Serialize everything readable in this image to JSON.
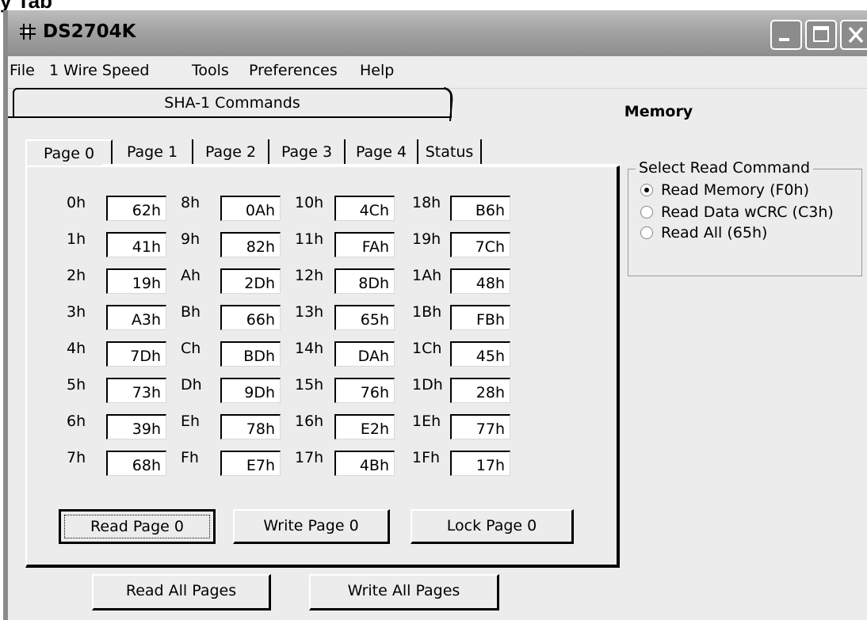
{
  "caption": "y Tab",
  "window": {
    "title": "DS2704K",
    "icon": "app-icon"
  },
  "menu": [
    "File",
    "1 Wire Speed",
    "Tools",
    "Preferences",
    "Help"
  ],
  "outer_tabs": {
    "left": "SHA-1 Commands",
    "right": "Memory",
    "active": "Memory"
  },
  "inner_tabs": [
    "Page 0",
    "Page 1",
    "Page 2",
    "Page 3",
    "Page 4",
    "Status"
  ],
  "active_inner_tab": "Page 0",
  "memory": [
    {
      "addr": "0h",
      "value": "62h"
    },
    {
      "addr": "1h",
      "value": "41h"
    },
    {
      "addr": "2h",
      "value": "19h"
    },
    {
      "addr": "3h",
      "value": "A3h"
    },
    {
      "addr": "4h",
      "value": "7Dh"
    },
    {
      "addr": "5h",
      "value": "73h"
    },
    {
      "addr": "6h",
      "value": "39h"
    },
    {
      "addr": "7h",
      "value": "68h"
    },
    {
      "addr": "8h",
      "value": "0Ah"
    },
    {
      "addr": "9h",
      "value": "82h"
    },
    {
      "addr": "Ah",
      "value": "2Dh"
    },
    {
      "addr": "Bh",
      "value": "66h"
    },
    {
      "addr": "Ch",
      "value": "BDh"
    },
    {
      "addr": "Dh",
      "value": "9Dh"
    },
    {
      "addr": "Eh",
      "value": "78h"
    },
    {
      "addr": "Fh",
      "value": "E7h"
    },
    {
      "addr": "10h",
      "value": "4Ch"
    },
    {
      "addr": "11h",
      "value": "FAh"
    },
    {
      "addr": "12h",
      "value": "8Dh"
    },
    {
      "addr": "13h",
      "value": "65h"
    },
    {
      "addr": "14h",
      "value": "DAh"
    },
    {
      "addr": "15h",
      "value": "76h"
    },
    {
      "addr": "16h",
      "value": "E2h"
    },
    {
      "addr": "17h",
      "value": "4Bh"
    },
    {
      "addr": "18h",
      "value": "B6h"
    },
    {
      "addr": "19h",
      "value": "7Ch"
    },
    {
      "addr": "1Ah",
      "value": "48h"
    },
    {
      "addr": "1Bh",
      "value": "FBh"
    },
    {
      "addr": "1Ch",
      "value": "45h"
    },
    {
      "addr": "1Dh",
      "value": "28h"
    },
    {
      "addr": "1Eh",
      "value": "77h"
    },
    {
      "addr": "1Fh",
      "value": "17h"
    }
  ],
  "page_buttons": {
    "read": "Read Page 0",
    "write": "Write Page 0",
    "lock": "Lock Page 0"
  },
  "bottom_buttons": {
    "read_all": "Read All Pages",
    "write_all": "Write All Pages"
  },
  "read_command": {
    "label": "Select Read Command",
    "options": [
      "Read Memory (F0h)",
      "Read Data wCRC (C3h)",
      "Read All (65h)"
    ],
    "selected": "Read Memory (F0h)"
  }
}
